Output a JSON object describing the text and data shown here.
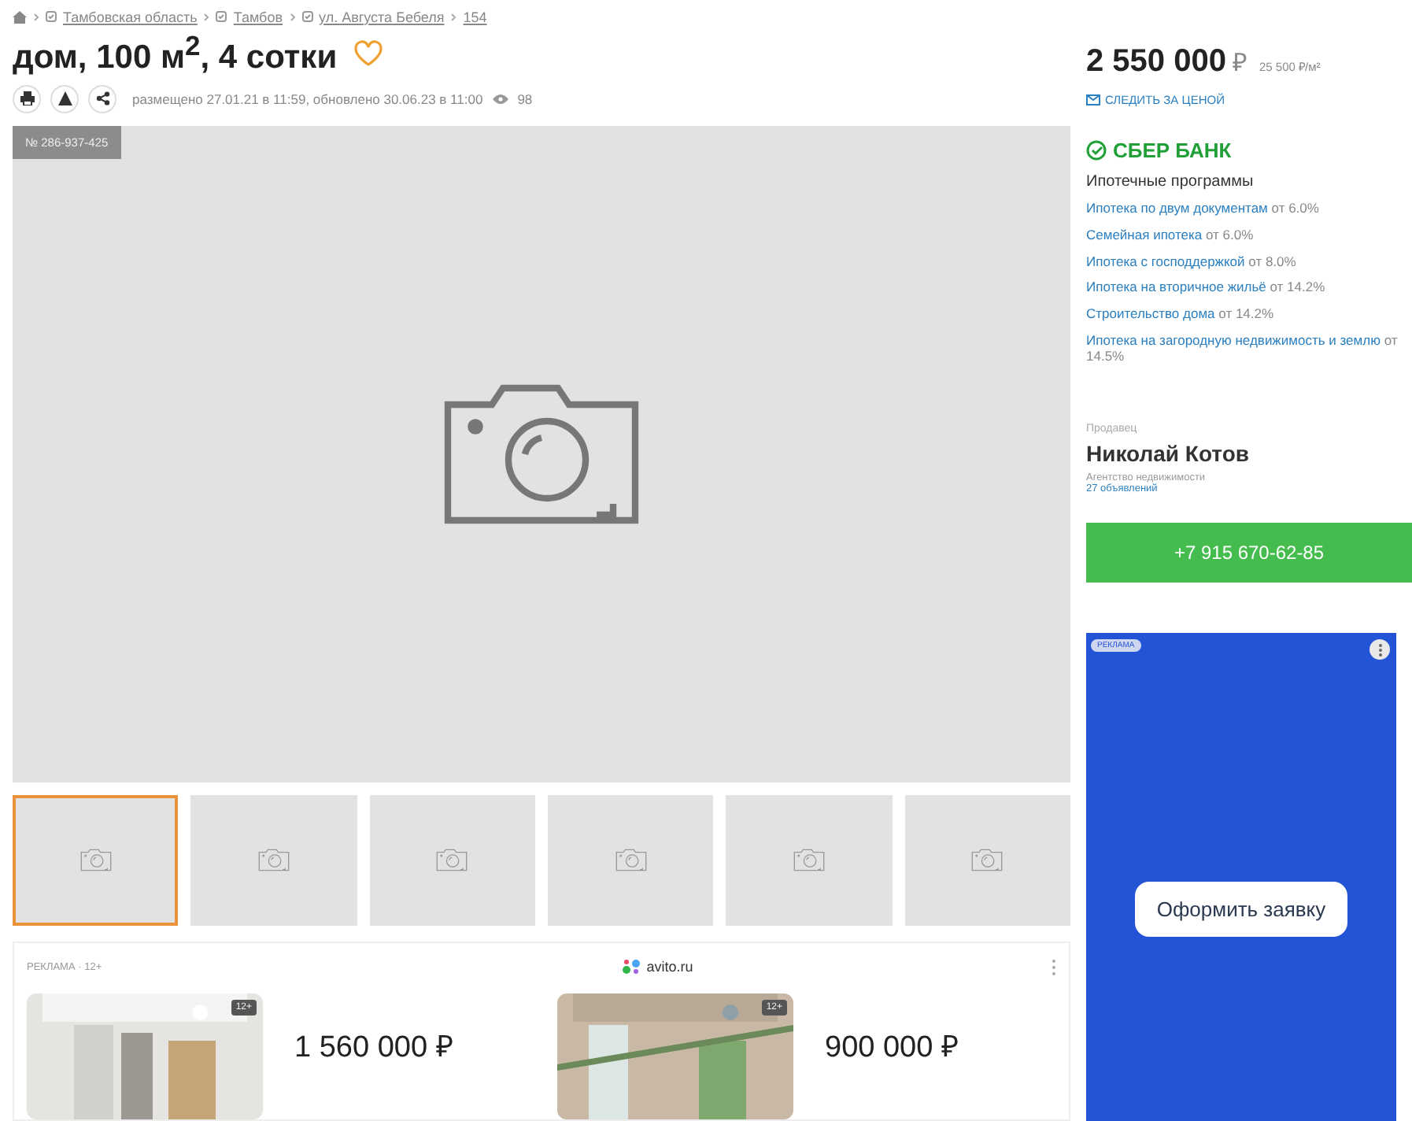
{
  "breadcrumbs": [
    "Тамбовская область",
    "Тамбов",
    "ул. Августа Бебеля",
    "154"
  ],
  "title": "дом, 100 м$^{2}$, 4 сотки",
  "favorite": false,
  "meta": {
    "posted": "размещено 27.01.21 в 11:59, обновлено 30.06.23 в 11:00",
    "views": "98"
  },
  "photo": {
    "id": "№ 286-937-425"
  },
  "thumbnails": [
    {
      "selected": true
    },
    {
      "selected": false
    },
    {
      "selected": false
    },
    {
      "selected": false
    },
    {
      "selected": false
    },
    {
      "selected": false
    }
  ],
  "price": {
    "amount": "2 550 000",
    "currency": "₽",
    "per_meter": "25 500 ₽/м²",
    "follow": "СЛЕДИТЬ ЗА ЦЕНОЙ"
  },
  "bank": {
    "name": "СБЕР БАНК",
    "heading": "Ипотечные программы",
    "programs": [
      {
        "link": "Ипотека по двум документам",
        "rate": "от 6.0%"
      },
      {
        "link": "Семейная ипотека",
        "rate": "от 6.0%"
      },
      {
        "link": "Ипотека с господдержкой",
        "rate": "от 8.0%"
      },
      {
        "link": "Ипотека на вторичное жильё",
        "rate": "от 14.2%"
      },
      {
        "link": "Строительство дома",
        "rate": "от 14.2%"
      },
      {
        "link": "Ипотека на загородную недвижимость и землю",
        "rate": "от 14.5%"
      }
    ]
  },
  "seller": {
    "label": "Продавец",
    "name": "Николай Котов",
    "type": "Агентство недвижимости",
    "listings": "27 объявлений",
    "phone": "+7 915 670-62-85"
  },
  "side_ad": {
    "badge": "РЕКЛАМА",
    "button": "Оформить заявку"
  },
  "bottom_ad": {
    "label": "РЕКЛАМА · 12+",
    "site": "avito.ru",
    "cards": [
      {
        "age": "12+",
        "price": "1 560 000 ₽"
      },
      {
        "age": "12+",
        "price": "900 000 ₽"
      }
    ]
  }
}
